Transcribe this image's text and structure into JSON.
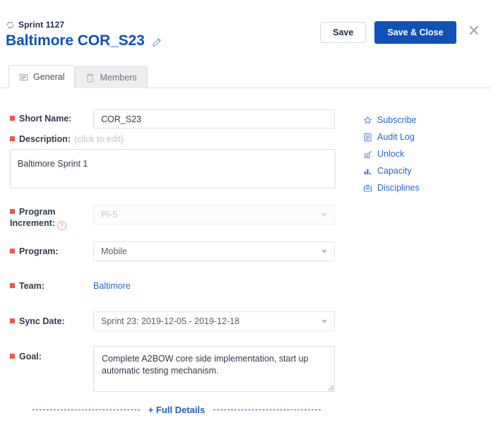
{
  "header": {
    "breadcrumb": "Sprint 1127",
    "breadcrumb_icon": "cycle-icon",
    "title": "Baltimore COR_S23",
    "edit_icon": "pencil-icon",
    "save_label": "Save",
    "save_close_label": "Save & Close",
    "close_label": "✕"
  },
  "tabs": [
    {
      "label": "General",
      "icon": "document-lines-icon",
      "active": true
    },
    {
      "label": "Members",
      "icon": "clipboard-icon",
      "active": false
    }
  ],
  "form": {
    "short_name": {
      "label": "Short Name:",
      "value": "COR_S23",
      "required": true
    },
    "description": {
      "label": "Description:",
      "hint": "(click to edit)",
      "value": "Baltimore Sprint 1",
      "required": true
    },
    "program_increment": {
      "label": "Program Increment:",
      "value": "PI-5",
      "required": true,
      "disabled": true,
      "help_icon": "question-circle-icon"
    },
    "program": {
      "label": "Program:",
      "value": "Mobile",
      "required": true
    },
    "team": {
      "label": "Team:",
      "value": "Baltimore",
      "required": true
    },
    "sync_date": {
      "label": "Sync Date:",
      "value": "Sprint 23: 2019-12-05 - 2019-12-18",
      "required": true
    },
    "goal": {
      "label": "Goal:",
      "value": "Complete A2BOW core side implementation, start up automatic testing mechanism.",
      "required": true
    }
  },
  "sidebar": {
    "items": [
      {
        "label": "Subscribe",
        "icon": "star-icon"
      },
      {
        "label": "Audit Log",
        "icon": "notepad-icon"
      },
      {
        "label": "Unlock",
        "icon": "open-padlock-icon"
      },
      {
        "label": "Capacity",
        "icon": "bar-chart-icon"
      },
      {
        "label": "Disciplines",
        "icon": "briefcase-icon"
      }
    ]
  },
  "footer": {
    "full_details_label": "+ Full Details"
  },
  "colors": {
    "accent_blue": "#0f52b5",
    "link_blue": "#2667c9",
    "required_red": "#f2554c",
    "text_dark": "#2f3b4d",
    "border_grey": "#dbdfe4"
  }
}
